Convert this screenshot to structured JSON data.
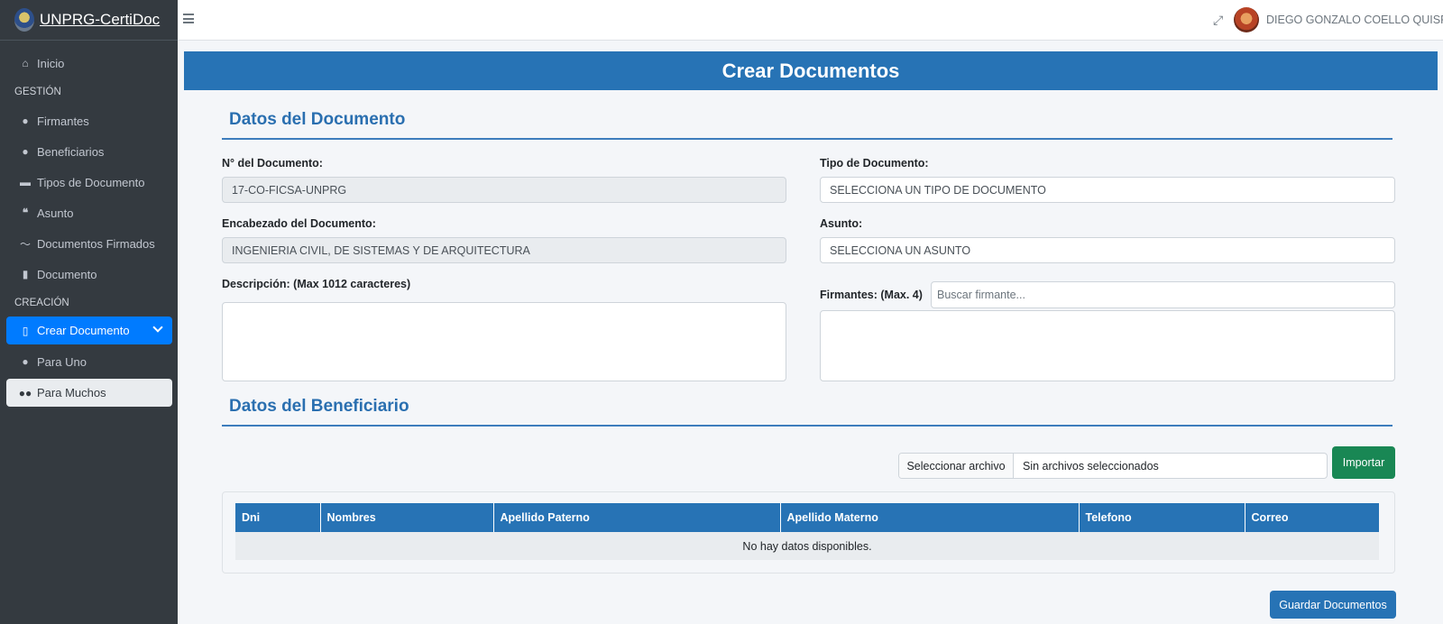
{
  "app": {
    "brand": "UNPRG-CertiDoc"
  },
  "topbar": {
    "user_name": "DIEGO GONZALO COELLO QUISPE"
  },
  "sidebar": {
    "items": [
      {
        "label": "Inicio",
        "icon": "home-icon"
      },
      {
        "header": "GESTIÓN"
      },
      {
        "label": "Firmantes",
        "icon": "user-tie-icon"
      },
      {
        "label": "Beneficiarios",
        "icon": "user-graduate-icon"
      },
      {
        "label": "Tipos de Documento",
        "icon": "folder-icon"
      },
      {
        "label": "Asunto",
        "icon": "quote-icon"
      },
      {
        "label": "Documentos Firmados",
        "icon": "signature-icon"
      },
      {
        "label": "Documento",
        "icon": "file-icon"
      },
      {
        "header": "CREACIÓN"
      },
      {
        "label": "Crear Documento",
        "icon": "file-outline-icon",
        "active": true
      },
      {
        "label": "Para Uno",
        "icon": "user-icon"
      },
      {
        "label": "Para Muchos",
        "icon": "users-icon",
        "selected": true
      }
    ]
  },
  "page": {
    "title": "Crear Documentos"
  },
  "documento": {
    "section_title": "Datos del Documento",
    "numero_label": "N° del Documento:",
    "numero_value": "17-CO-FICSA-UNPRG",
    "tipo_label": "Tipo de Documento:",
    "tipo_value": "SELECCIONA UN TIPO DE DOCUMENTO",
    "encabezado_label": "Encabezado del Documento:",
    "encabezado_value": "INGENIERIA CIVIL, DE SISTEMAS Y DE ARQUITECTURA",
    "asunto_label": "Asunto:",
    "asunto_value": "SELECCIONA UN ASUNTO",
    "descripcion_label": "Descripción: (Max 1012 caracteres)",
    "firmantes_label": "Firmantes: (Max. 4)",
    "firmantes_placeholder": "Buscar firmante..."
  },
  "beneficiario": {
    "section_title": "Datos del Beneficiario",
    "file_button": "Seleccionar archivo",
    "file_status": "Sin archivos seleccionados",
    "import_button": "Importar",
    "table": {
      "columns": [
        "Dni",
        "Nombres",
        "Apellido Paterno",
        "Apellido Materno",
        "Telefono",
        "Correo"
      ],
      "empty_message": "No hay datos disponibles."
    },
    "save_button": "Guardar Documentos"
  },
  "colors": {
    "primary": "#2773b5",
    "sidebar": "#343a40",
    "active": "#007bff",
    "success": "#198754"
  }
}
